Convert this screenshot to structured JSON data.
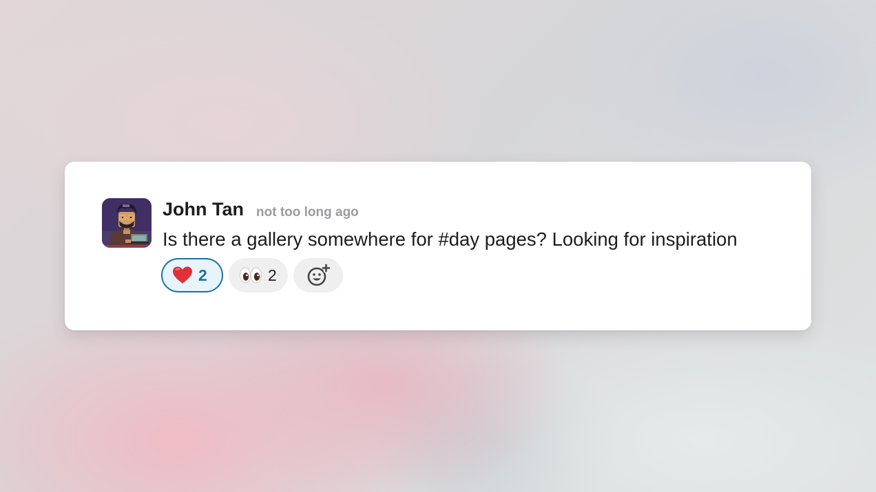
{
  "message": {
    "author": "John Tan",
    "timestamp": "not too long ago",
    "text": "Is there a gallery somewhere for #day pages? Looking for inspiration",
    "avatar_icon": "pixel-art-avatar"
  },
  "reactions": [
    {
      "emoji": "heart-emoji",
      "count": "2",
      "selected": true,
      "accent": "#1d6fa8"
    },
    {
      "emoji": "eyes-emoji",
      "count": "2",
      "selected": false
    }
  ],
  "add_reaction": {
    "icon": "add-emoji-icon"
  }
}
